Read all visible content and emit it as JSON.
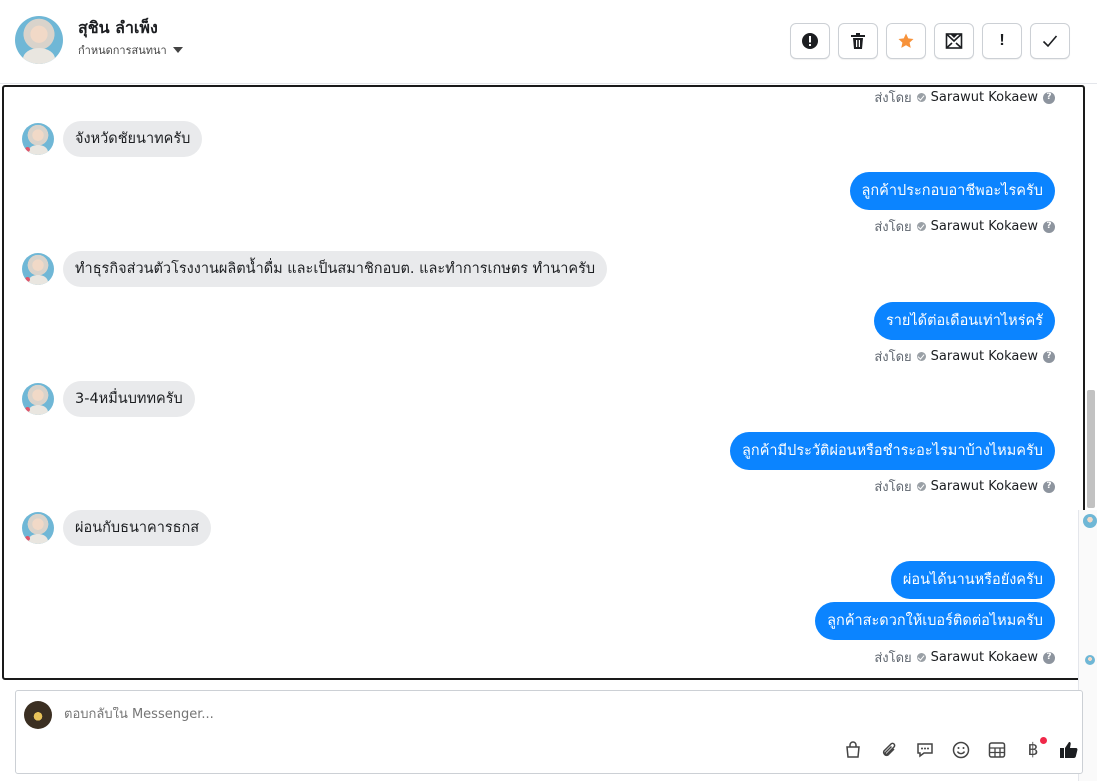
{
  "header": {
    "user_name": "สุชิน ลำเพ็ง",
    "conversation_settings": "กำหนดการสนทนา",
    "toolbar": [
      {
        "name": "report-button",
        "icon": "exclamation-circle-icon"
      },
      {
        "name": "delete-button",
        "icon": "trash-icon"
      },
      {
        "name": "star-button",
        "icon": "star-icon",
        "color": "#f7923a"
      },
      {
        "name": "mark-unread-button",
        "icon": "envelope-icon"
      },
      {
        "name": "important-button",
        "icon": "exclamation-icon",
        "label": "!"
      },
      {
        "name": "done-button",
        "icon": "checkmark-icon"
      }
    ]
  },
  "messages": {
    "sent_by_label": "ส่งโดย",
    "agent_name": "Sarawut Kokaew",
    "help": "?",
    "m1": "จังหวัดชัยนาทครับ",
    "m2": "ลูกค้าประกอบอาชีพอะไรครับ",
    "m3": "ทำธุรกิจส่วนตัวโรงงานผลิตน้ำดื่ม และเป็นสมาชิกอบต. และทำการเกษตร ทำนาครับ",
    "m4": "รายได้ต่อเดือนเท่าไหร่ครั",
    "m5": "3-4หมื่นบททครับ",
    "m6": "ลูกค้ามีประวัติผ่อนหรือชำระอะไรมาบ้างไหมครับ",
    "m7": "ผ่อนกับธนาคารธกส",
    "m8": "ผ่อนได้นานหรือยังครับ",
    "m9": "ลูกค้าสะดวกให้เบอร์ติดต่อไหมครับ"
  },
  "composer": {
    "placeholder": "ตอบกลับใน Messenger...",
    "tools": [
      "bag-icon",
      "paperclip-icon",
      "chat-bubble-icon",
      "emoji-icon",
      "table-icon",
      "baht-icon",
      "thumbs-up-icon"
    ]
  },
  "colors": {
    "outgoing_bubble": "#0b84ff",
    "incoming_bubble": "#e9eaec",
    "star": "#f7923a",
    "notification_dot": "#f02849"
  }
}
